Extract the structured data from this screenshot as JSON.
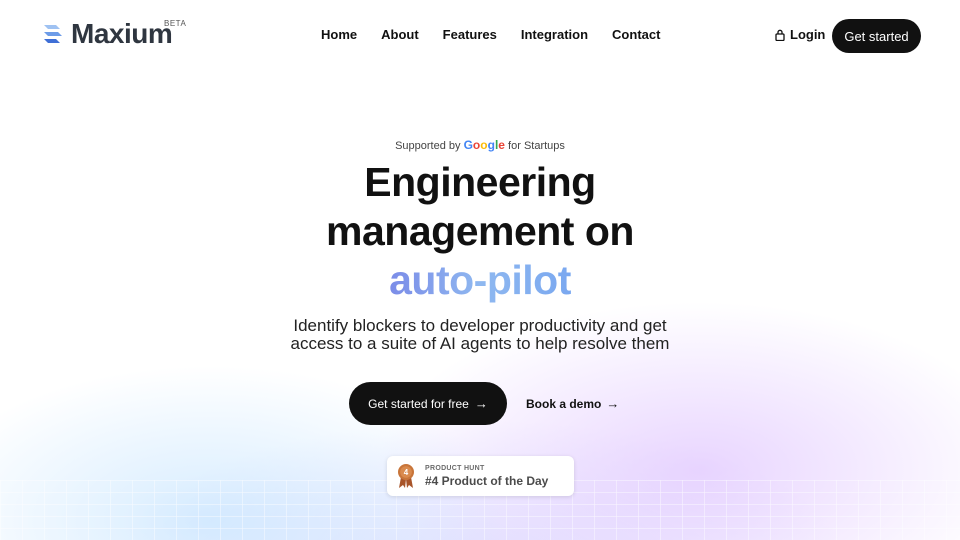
{
  "brand": {
    "name": "Maxium",
    "tag": "BETA"
  },
  "nav": {
    "items": [
      "Home",
      "About",
      "Features",
      "Integration",
      "Contact"
    ]
  },
  "header": {
    "login_label": "Login",
    "cta_label": "Get started"
  },
  "hero": {
    "supported_prefix": "Supported by",
    "google_letters": [
      "G",
      "o",
      "o",
      "g",
      "l",
      "e"
    ],
    "supported_suffix": "for Startups",
    "headline_line1": "Engineering",
    "headline_line2": "management on",
    "headline_accent": "auto-pilot",
    "sub_line1": "Identify blockers to developer productivity and get",
    "sub_line2": "access to a suite of AI agents to help resolve them",
    "primary_cta": "Get started for free",
    "secondary_cta": "Book a demo"
  },
  "badge": {
    "source": "PRODUCT HUNT",
    "title": "#4 Product of the Day",
    "medal_number": "4"
  },
  "colors": {
    "dark": "#111111",
    "accent_gradient_start": "#7b8ce8",
    "accent_gradient_end": "#7aa8f0",
    "medal": "#c8753a"
  }
}
